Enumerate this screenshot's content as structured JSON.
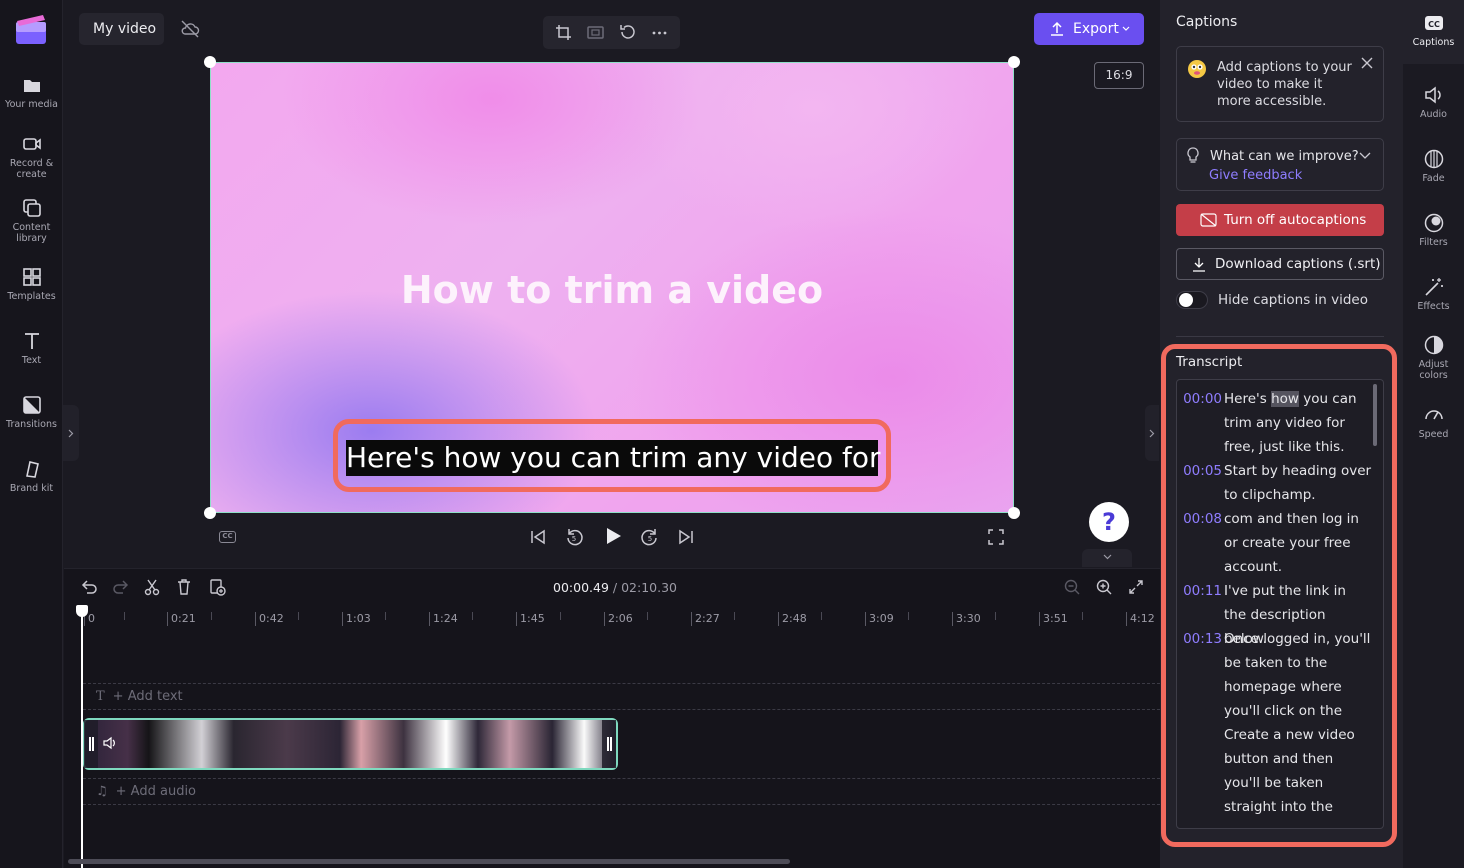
{
  "project": {
    "title": "My video"
  },
  "left_nav": [
    {
      "label": "Your media",
      "icon": "folder-icon"
    },
    {
      "label": "Record &\ncreate",
      "icon": "camera-icon"
    },
    {
      "label": "Content\nlibrary",
      "icon": "library-icon"
    },
    {
      "label": "Templates",
      "icon": "templates-icon"
    },
    {
      "label": "Text",
      "icon": "text-icon"
    },
    {
      "label": "Transitions",
      "icon": "transitions-icon"
    },
    {
      "label": "Brand kit",
      "icon": "brand-kit-icon"
    }
  ],
  "toolbar": {
    "export_label": "Export",
    "aspect_ratio": "16:9"
  },
  "preview": {
    "title_text": "How to trim a video",
    "caption_text": "Here's how you can trim any video for",
    "help_label": "?"
  },
  "timeline": {
    "current_time": "00:00.49",
    "total_time": "/ 02:10.30",
    "ticks": [
      "0",
      "0:21",
      "0:42",
      "1:03",
      "1:24",
      "1:45",
      "2:06",
      "2:27",
      "2:48",
      "3:09",
      "3:30",
      "3:51",
      "4:12"
    ],
    "add_text_label": "+ Add text",
    "add_audio_label": "+ Add audio"
  },
  "captions_panel": {
    "title": "Captions",
    "info_text": "Add captions to your video to make it more accessible.",
    "feedback_question": "What can we improve?",
    "feedback_link": "Give feedback",
    "autocaptions_label": "Turn off autocaptions",
    "download_label": "Download captions (.srt)",
    "hide_toggle_label": "Hide captions in video",
    "transcript_title": "Transcript",
    "transcript": [
      {
        "time": "00:00",
        "pre": "Here's ",
        "hl": "how",
        "post": " you can trim any video for free, just like this."
      },
      {
        "time": "00:05",
        "pre": "Start by heading over to clipchamp.",
        "hl": "",
        "post": ""
      },
      {
        "time": "00:08",
        "pre": "com and then log in or create your free account.",
        "hl": "",
        "post": ""
      },
      {
        "time": "00:11",
        "pre": "I've put the link in the description below.",
        "hl": "",
        "post": ""
      },
      {
        "time": "00:13",
        "pre": "Once logged in, you'll be taken to the homepage where you'll click on the Create a new video button and then you'll be taken straight into the editor.",
        "hl": "",
        "post": ""
      }
    ]
  },
  "right_rail": [
    {
      "label": "Captions",
      "icon": "captions-icon"
    },
    {
      "label": "Audio",
      "icon": "audio-icon"
    },
    {
      "label": "Fade",
      "icon": "fade-icon"
    },
    {
      "label": "Filters",
      "icon": "filters-icon"
    },
    {
      "label": "Effects",
      "icon": "effects-icon"
    },
    {
      "label": "Adjust\ncolors",
      "icon": "adjust-colors-icon"
    },
    {
      "label": "Speed",
      "icon": "speed-icon"
    }
  ],
  "colors": {
    "accent": "#6a4ff0",
    "highlight": "#f16a5e",
    "danger": "#c43e48",
    "link": "#8f7dff"
  }
}
